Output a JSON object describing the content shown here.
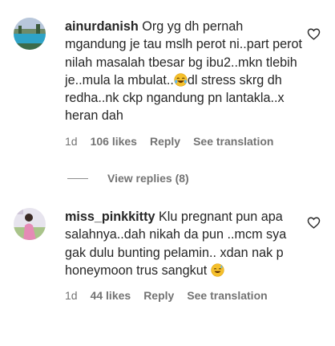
{
  "comments": [
    {
      "username": "ainurdanish",
      "text_before_emoji": "Org yg dh pernah mgandung je tau mslh perot ni..part perot nilah masalah tbesar bg ibu2..mkn tlebih je..mula la mbulat..",
      "emoji": "😂",
      "text_after_emoji": "dl stress skrg dh redha..nk ckp ngandung pn lantakla..x heran dah",
      "time": "1d",
      "likes": "106 likes",
      "reply": "Reply",
      "translate": "See translation"
    },
    {
      "username": "miss_pinkkitty",
      "text_before_emoji": "Klu pregnant pun apa salahnya..dah nikah da pun ..mcm sya gak dulu bunting pelamin.. xdan nak p honeymoon trus sangkut",
      "emoji": "😅",
      "text_after_emoji": "",
      "time": "1d",
      "likes": "44 likes",
      "reply": "Reply",
      "translate": "See translation"
    }
  ],
  "view_replies": "View replies (8)",
  "icons": {
    "like": "heart-outline-icon"
  },
  "colors": {
    "text": "#262626",
    "secondary": "#737373",
    "background": "#ffffff"
  }
}
